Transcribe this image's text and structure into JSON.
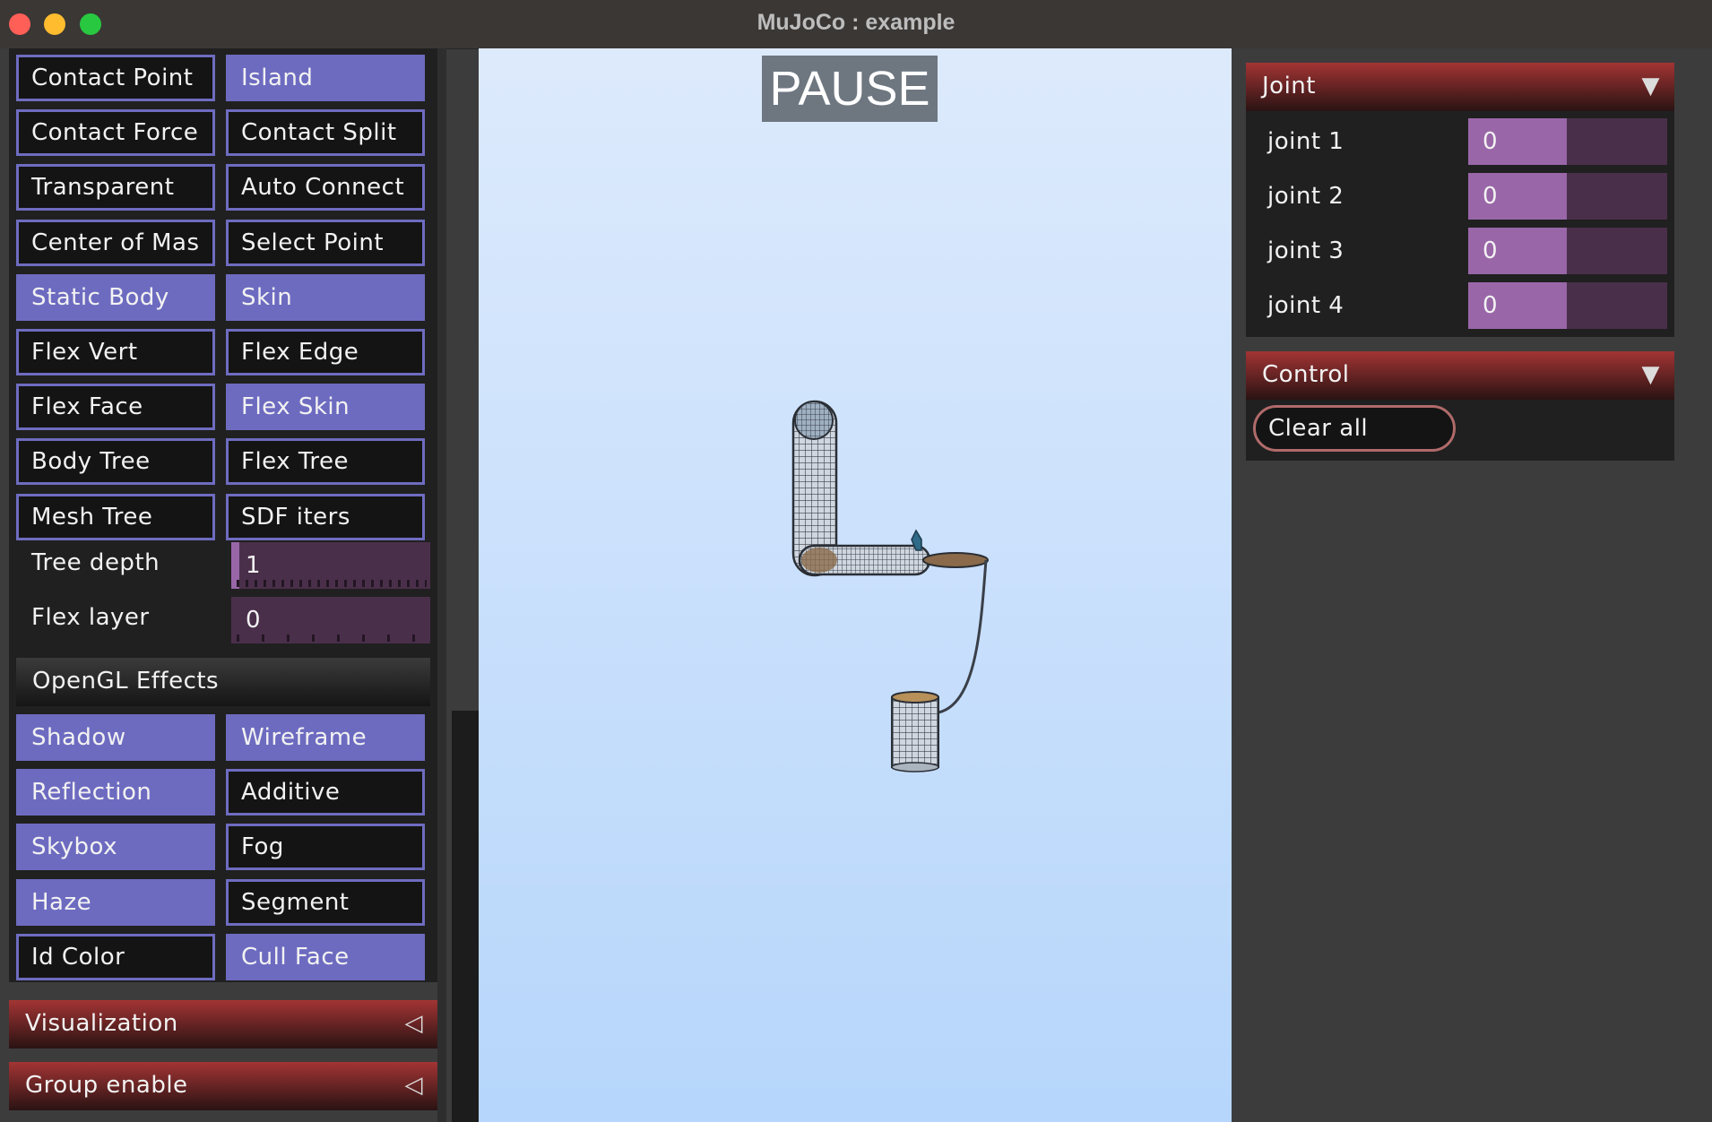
{
  "window": {
    "title": "MuJoCo : example"
  },
  "left_panel": {
    "toggles_top": [
      {
        "label": "Contact Point",
        "on": false
      },
      {
        "label": "Island",
        "on": true
      },
      {
        "label": "Contact Force",
        "on": false
      },
      {
        "label": "Contact Split",
        "on": false
      },
      {
        "label": "Transparent",
        "on": false
      },
      {
        "label": "Auto Connect",
        "on": false
      },
      {
        "label": "Center of Mas",
        "on": false
      },
      {
        "label": "Select Point",
        "on": false
      },
      {
        "label": "Static Body",
        "on": true
      },
      {
        "label": "Skin",
        "on": true
      },
      {
        "label": "Flex Vert",
        "on": false
      },
      {
        "label": "Flex Edge",
        "on": false
      },
      {
        "label": "Flex Face",
        "on": false
      },
      {
        "label": "Flex Skin",
        "on": true
      },
      {
        "label": "Body Tree",
        "on": false
      },
      {
        "label": "Flex Tree",
        "on": false
      },
      {
        "label": "Mesh Tree",
        "on": false
      },
      {
        "label": "SDF iters",
        "on": false
      }
    ],
    "sliders": [
      {
        "label": "Tree depth",
        "value": "1",
        "fraction": 0.04
      },
      {
        "label": "Flex layer",
        "value": "0",
        "fraction": 0.0
      }
    ],
    "opengl_header": "OpenGL Effects",
    "toggles_opengl": [
      {
        "label": "Shadow",
        "on": true
      },
      {
        "label": "Wireframe",
        "on": true
      },
      {
        "label": "Reflection",
        "on": true
      },
      {
        "label": "Additive",
        "on": false
      },
      {
        "label": "Skybox",
        "on": true
      },
      {
        "label": "Fog",
        "on": false
      },
      {
        "label": "Haze",
        "on": true
      },
      {
        "label": "Segment",
        "on": false
      },
      {
        "label": "Id Color",
        "on": false
      },
      {
        "label": "Cull Face",
        "on": true
      }
    ],
    "sections": [
      {
        "label": "Visualization",
        "arrow": "◁"
      },
      {
        "label": "Group enable",
        "arrow": "◁"
      }
    ]
  },
  "viewport": {
    "status": "PAUSE"
  },
  "right_panel": {
    "joint_section": {
      "label": "Joint",
      "arrow": "▼",
      "joints": [
        {
          "label": "joint 1",
          "value": "0"
        },
        {
          "label": "joint 2",
          "value": "0"
        },
        {
          "label": "joint 3",
          "value": "0"
        },
        {
          "label": "joint 4",
          "value": "0"
        }
      ]
    },
    "control_section": {
      "label": "Control",
      "arrow": "▼",
      "clear_label": "Clear all"
    }
  },
  "colors": {
    "toggle_on": "#6d6bc0",
    "section_header": "#a33434",
    "slider_fill": "#9966a8",
    "slider_track": "#4a2f4a"
  }
}
